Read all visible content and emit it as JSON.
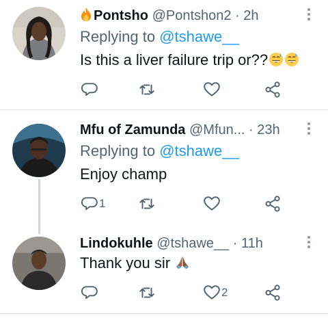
{
  "tweets": [
    {
      "name": "Pontsho",
      "handle": "@Pontshon2",
      "dot": "·",
      "time": "2h",
      "replying_prefix": "Replying to ",
      "replying_to": "@tshawe__",
      "text": "Is this a liver failure trip or??",
      "emoji": [
        "grinning-sweat-emoji",
        "grinning-sweat-emoji"
      ],
      "name_icon": "fire-icon",
      "counts": {
        "reply": "",
        "retweet": "",
        "like": ""
      }
    },
    {
      "name": "Mfu of Zamunda",
      "handle": "@Mfun...",
      "dot": "·",
      "time": "23h",
      "replying_prefix": "Replying to ",
      "replying_to": "@tshawe__",
      "text": "Enjoy champ",
      "counts": {
        "reply": "1",
        "retweet": "",
        "like": ""
      }
    },
    {
      "name": "Lindokuhle",
      "handle": "@tshawe__",
      "dot": "·",
      "time": "11h",
      "text": "Thank you sir",
      "emoji": [
        "folded-hands-emoji"
      ],
      "counts": {
        "reply": "",
        "retweet": "",
        "like": "2"
      }
    }
  ],
  "icons": {
    "reply": "reply-icon",
    "retweet": "retweet-icon",
    "like": "heart-icon",
    "share": "share-icon",
    "more": "more-icon"
  },
  "colors": {
    "link": "#1d9bf0",
    "secondary_text": "#536471",
    "thread_line": "#cfd9de"
  }
}
